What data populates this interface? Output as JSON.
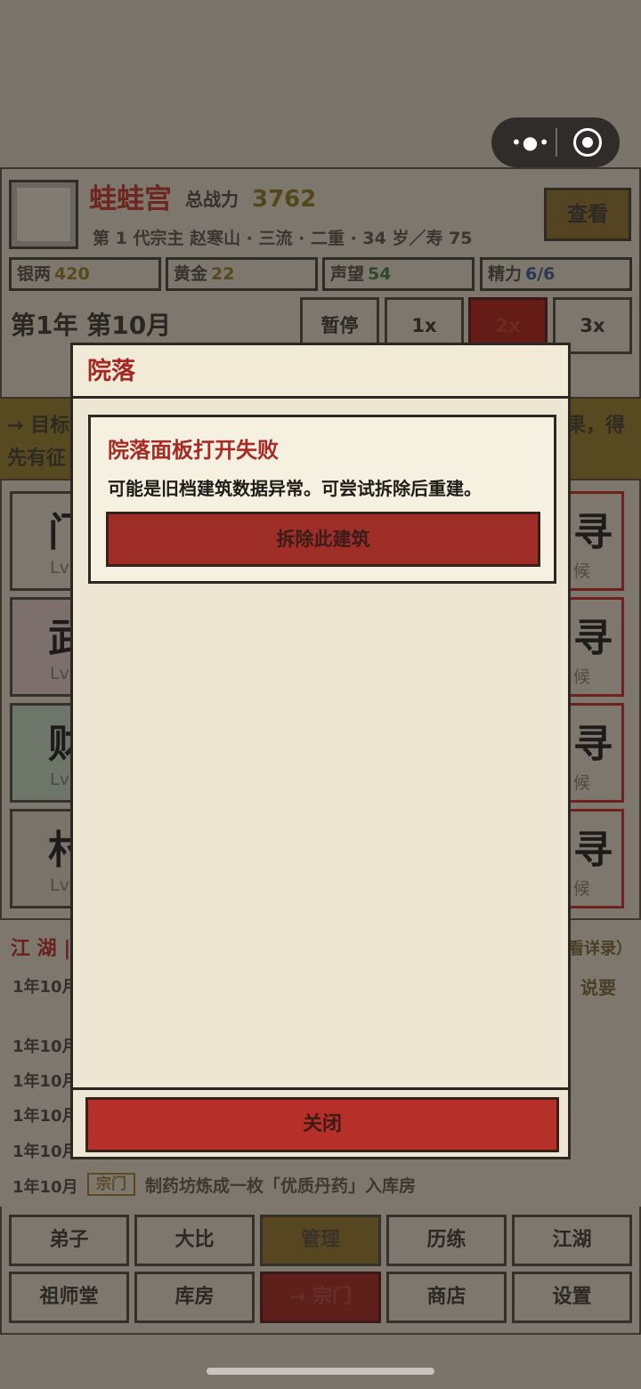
{
  "capsule": {
    "more_icon": "ellipsis-icon",
    "close_icon": "target-icon"
  },
  "header": {
    "sect_name": "蛙蛙宫",
    "power_label": "总战力",
    "power_value": "3762",
    "leader_line": "第 1 代宗主 赵寒山 · 三流 · 二重 · 34 岁／寿 75",
    "view_label": "查看"
  },
  "resources": [
    {
      "label": "银两",
      "value": "420"
    },
    {
      "label": "黄金",
      "value": "22"
    },
    {
      "label": "声望",
      "value": "54"
    },
    {
      "label": "精力",
      "value": "6/6"
    }
  ],
  "time": {
    "date": "第1年 第10月",
    "speed_buttons": [
      "暂停",
      "1x",
      "2x",
      "3x"
    ],
    "active_speed": "2x"
  },
  "goal": {
    "line1": "→ 目标",
    "line2": "先有征",
    "right": "果，得"
  },
  "cards_left": [
    {
      "glyph": "门",
      "lv": "Lv"
    },
    {
      "glyph": "武",
      "lv": "Lv"
    },
    {
      "glyph": "财",
      "lv": "Lv"
    },
    {
      "glyph": "村",
      "lv": "Lv"
    }
  ],
  "cards_right": [
    {
      "glyph": "寻",
      "lv": "候"
    },
    {
      "glyph": "寻",
      "lv": "候"
    },
    {
      "glyph": "寻",
      "lv": "候"
    },
    {
      "glyph": "寻",
      "lv": "候"
    }
  ],
  "log": {
    "title": "江 湖 |",
    "more": "看详录）",
    "say": "说要",
    "dates": [
      "1年10月",
      "1年10月",
      "1年10月",
      "1年10月",
      "1年10月"
    ],
    "last": {
      "date": "1年10月",
      "tag": "宗门",
      "text": "制药坊炼成一枚「优质丹药」入库房"
    }
  },
  "nav": {
    "row1": [
      "弟子",
      "大比",
      "管理",
      "历练",
      "江湖"
    ],
    "row2": [
      "祖师堂",
      "库房",
      "→ 宗门",
      "商店",
      "设置"
    ]
  },
  "modal": {
    "title": "院落",
    "error_title": "院落面板打开失败",
    "error_message": "可能是旧档建筑数据异常。可尝试拆除后重建。",
    "demolish_label": "拆除此建筑",
    "close_label": "关闭"
  }
}
